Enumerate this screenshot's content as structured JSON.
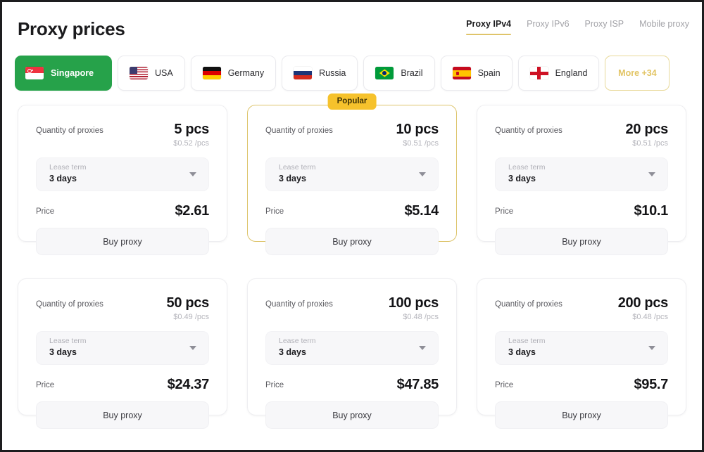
{
  "header": {
    "title": "Proxy prices",
    "nav_tabs": [
      {
        "label": "Proxy IPv4",
        "active": true
      },
      {
        "label": "Proxy IPv6",
        "active": false
      },
      {
        "label": "Proxy ISP",
        "active": false
      },
      {
        "label": "Mobile proxy",
        "active": false
      }
    ],
    "active_accent": "#dfc46a"
  },
  "countries": {
    "active_color": "#26a24a",
    "more_color": "#e2c463",
    "items": [
      {
        "label": "Singapore",
        "flag": "flag-sg",
        "active": true
      },
      {
        "label": "USA",
        "flag": "flag-us",
        "active": false
      },
      {
        "label": "Germany",
        "flag": "flag-de",
        "active": false
      },
      {
        "label": "Russia",
        "flag": "flag-ru",
        "active": false
      },
      {
        "label": "Brazil",
        "flag": "flag-br",
        "active": false
      },
      {
        "label": "Spain",
        "flag": "flag-es",
        "active": false
      },
      {
        "label": "England",
        "flag": "flag-en",
        "active": false
      }
    ],
    "more_label": "More +34"
  },
  "labels": {
    "quantity": "Quantity of proxies",
    "lease_term": "Lease term",
    "price": "Price",
    "buy": "Buy proxy",
    "popular_badge": "Popular"
  },
  "badge_color": "#f6c22c",
  "cards": [
    {
      "quantity": "5 pcs",
      "unit_price": "$0.52 /pcs",
      "lease_term": "3 days",
      "price": "$2.61",
      "featured": false
    },
    {
      "quantity": "10 pcs",
      "unit_price": "$0.51 /pcs",
      "lease_term": "3 days",
      "price": "$5.14",
      "featured": true
    },
    {
      "quantity": "20 pcs",
      "unit_price": "$0.51 /pcs",
      "lease_term": "3 days",
      "price": "$10.1",
      "featured": false
    },
    {
      "quantity": "50 pcs",
      "unit_price": "$0.49 /pcs",
      "lease_term": "3 days",
      "price": "$24.37",
      "featured": false
    },
    {
      "quantity": "100 pcs",
      "unit_price": "$0.48 /pcs",
      "lease_term": "3 days",
      "price": "$47.85",
      "featured": false
    },
    {
      "quantity": "200 pcs",
      "unit_price": "$0.48 /pcs",
      "lease_term": "3 days",
      "price": "$95.7",
      "featured": false
    }
  ]
}
